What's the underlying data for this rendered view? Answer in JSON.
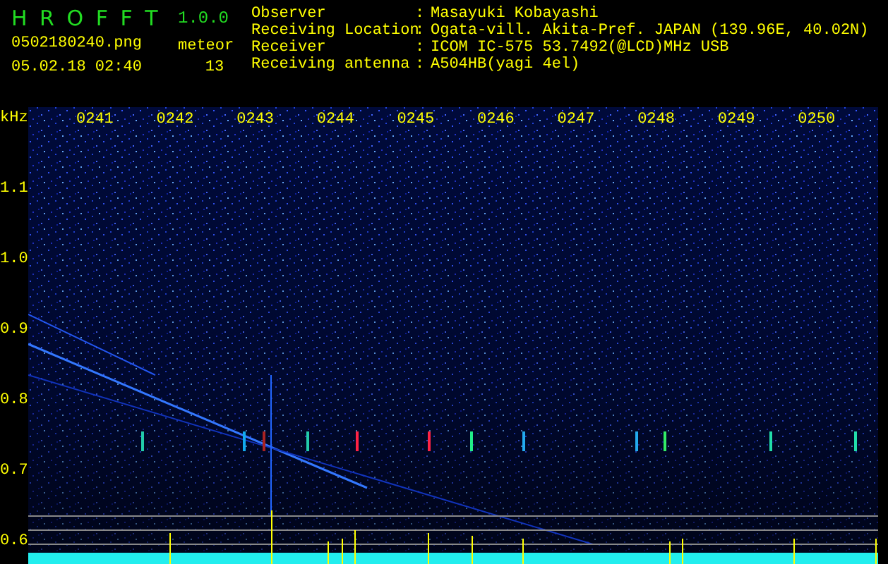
{
  "app": {
    "name": "H R O F F T",
    "version": "1.0.0"
  },
  "file": {
    "name": "0502180240.png",
    "datetime": "05.02.18 02:40"
  },
  "meteor": {
    "label": "meteor",
    "count": "13"
  },
  "info": [
    {
      "label": "Observer",
      "separator": ":",
      "value": "Masayuki Kobayashi"
    },
    {
      "label": "Receiving Location",
      "separator": ":",
      "value": "Ogata-vill. Akita-Pref. JAPAN (139.96E, 40.02N)"
    },
    {
      "label": "Receiver",
      "separator": ":",
      "value": "ICOM IC-575 53.7492(@LCD)MHz USB"
    },
    {
      "label": "Receiving antenna",
      "separator": ":",
      "value": "A504HB(yagi 4el)"
    }
  ],
  "axis": {
    "unit": "kHz",
    "frequency_labels": [
      "1.1",
      "1.0",
      "0.9",
      "0.8",
      "0.7",
      "0.6"
    ],
    "time_labels": [
      "0241",
      "0242",
      "0243",
      "0244",
      "0245",
      "0246",
      "0247",
      "0248",
      "0249",
      "0250"
    ]
  }
}
